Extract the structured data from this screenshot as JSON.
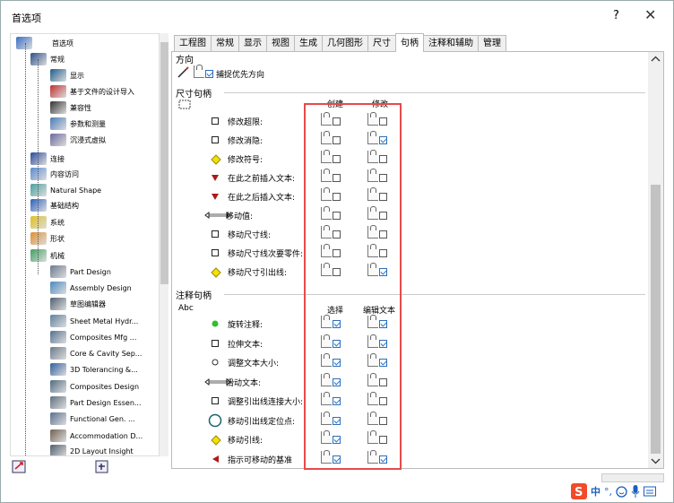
{
  "window": {
    "title": "首选项",
    "help": "?",
    "close": "✕"
  },
  "tree": [
    {
      "label": "首选项",
      "icon": "options-icon",
      "color": "#3a6fc4"
    },
    {
      "label": "常规",
      "icon": "general-icon",
      "color": "#2c4f8c"
    },
    {
      "label": "显示",
      "icon": "display-icon",
      "color": "#1f5d8c"
    },
    {
      "label": "基于文件的设计导入",
      "icon": "import-icon",
      "color": "#c03030"
    },
    {
      "label": "兼容性",
      "icon": "compat-icon",
      "color": "#333"
    },
    {
      "label": "参数和测量",
      "icon": "params-icon",
      "color": "#4a7ab8"
    },
    {
      "label": "沉浸式虚拟",
      "icon": "immersive-icon",
      "color": "#6a6aa0"
    },
    {
      "label": "连接",
      "icon": "connect-icon",
      "color": "#2a4a9a"
    },
    {
      "label": "内容访问",
      "icon": "content-icon",
      "color": "#5a8ad0"
    },
    {
      "label": "Natural Shape",
      "icon": "shape-icon",
      "color": "#4aa0a0"
    },
    {
      "label": "基础结构",
      "icon": "infra-icon",
      "color": "#2a60c0"
    },
    {
      "label": "系统",
      "icon": "system-icon",
      "color": "#e0c020"
    },
    {
      "label": "形状",
      "icon": "form-icon",
      "color": "#e09030"
    },
    {
      "label": "机械",
      "icon": "mech-icon",
      "color": "#40a060"
    },
    {
      "label": "Part Design",
      "icon": "part-icon",
      "color": "#6a7a90"
    },
    {
      "label": "Assembly Design",
      "icon": "assembly-icon",
      "color": "#4a8ac0"
    },
    {
      "label": "草图编辑器",
      "icon": "sketch-icon",
      "color": "#506070"
    },
    {
      "label": "Sheet Metal Hydr...",
      "icon": "sheetmetal-icon",
      "color": "#6080a0"
    },
    {
      "label": "Composites Mfg ...",
      "icon": "composites-icon",
      "color": "#557090"
    },
    {
      "label": "Core & Cavity Sep...",
      "icon": "core-icon",
      "color": "#6a7a8a"
    },
    {
      "label": "3D Tolerancing &...",
      "icon": "tol-icon",
      "color": "#3060a0"
    },
    {
      "label": "Composites Design",
      "icon": "compdesign-icon",
      "color": "#506a80"
    },
    {
      "label": "Part Design Essen...",
      "icon": "essen-icon",
      "color": "#607080"
    },
    {
      "label": "Functional Gen. ...",
      "icon": "func-icon",
      "color": "#5a7090"
    },
    {
      "label": "Accommodation D...",
      "icon": "accom-icon",
      "color": "#706050"
    },
    {
      "label": "2D Layout Insight",
      "icon": "layout-icon",
      "color": "#506070"
    }
  ],
  "tabs": [
    "工程图",
    "常规",
    "显示",
    "视图",
    "生成",
    "几何图形",
    "尺寸",
    "句柄",
    "注释和辅助",
    "管理"
  ],
  "active_tab": "句柄",
  "direction": {
    "title": "方向",
    "capture": "捕捉优先方向",
    "capture_checked": true
  },
  "dim_handles": {
    "title": "尺寸句柄",
    "col1": "创建",
    "col2": "修改",
    "rows": [
      {
        "label": "修改超限:",
        "icon": "square",
        "c1": false,
        "c2": false
      },
      {
        "label": "修改消隐:",
        "icon": "square",
        "c1": false,
        "c2": true
      },
      {
        "label": "修改符号:",
        "icon": "diamond",
        "c1": false,
        "c2": false
      },
      {
        "label": "在此之前插入文本:",
        "icon": "tri-down",
        "c1": false,
        "c2": false
      },
      {
        "label": "在此之后插入文本:",
        "icon": "tri-down",
        "c1": false,
        "c2": false
      },
      {
        "label": "移动值:",
        "icon": "arrows",
        "c1": false,
        "c2": false
      },
      {
        "label": "移动尺寸线:",
        "icon": "square",
        "c1": false,
        "c2": false
      },
      {
        "label": "移动尺寸线次要零件:",
        "icon": "square",
        "c1": false,
        "c2": false
      },
      {
        "label": "移动尺寸引出线:",
        "icon": "diamond",
        "c1": false,
        "c2": true
      }
    ]
  },
  "ann_handles": {
    "title": "注释句柄",
    "sub": "Abc",
    "col1": "选择",
    "col2": "编辑文本",
    "rows": [
      {
        "label": "旋转注释:",
        "icon": "dot-green",
        "c1": true,
        "c2": true
      },
      {
        "label": "拉伸文本:",
        "icon": "square",
        "c1": true,
        "c2": true
      },
      {
        "label": "调整文本大小:",
        "icon": "circle-small",
        "c1": true,
        "c2": true
      },
      {
        "label": "滑动文本:",
        "icon": "arrows",
        "c1": true,
        "c2": false
      },
      {
        "label": "调整引出线连接大小:",
        "icon": "square",
        "c1": true,
        "c2": false
      },
      {
        "label": "移动引出线定位点:",
        "icon": "circle-big",
        "c1": true,
        "c2": false
      },
      {
        "label": "移动引线:",
        "icon": "diamond",
        "c1": true,
        "c2": false
      },
      {
        "label": "指示可移动的基准",
        "icon": "tri-left",
        "c1": true,
        "c2": true
      }
    ]
  },
  "ime": {
    "label": "中",
    "extra": "°,"
  }
}
